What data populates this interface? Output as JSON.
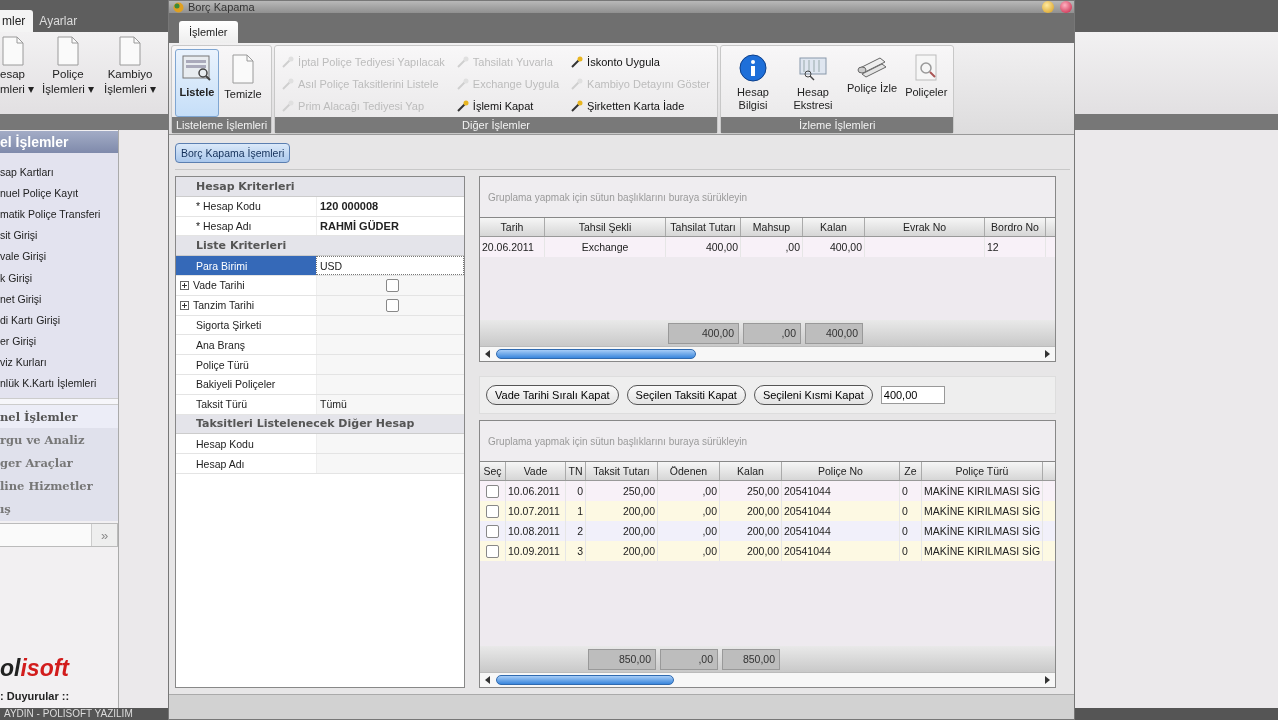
{
  "app": {
    "tabs": [
      {
        "label": "mler",
        "selected": true
      },
      {
        "label": "Ayarlar",
        "selected": false
      }
    ],
    "ribbon": [
      {
        "line1": "esap",
        "line2": "mleri",
        "caret": "▾"
      },
      {
        "line1": "Poliçe",
        "line2": "İşlemleri",
        "caret": "▾"
      },
      {
        "line1": "Kambiyo",
        "line2": "İşlemleri",
        "caret": "▾"
      }
    ],
    "sidebar": {
      "title": "el İşlemler",
      "items": [
        "sap Kartları",
        "nuel Poliçe Kayıt",
        "matik Poliçe Transferi",
        "sit Girişi",
        "vale Girişi",
        "k Girişi",
        "net Girişi",
        "di Kartı Girişi",
        "er Girişi",
        "viz Kurları",
        "nlük K.Kartı İşlemleri"
      ],
      "groups": [
        {
          "label": "nel İşlemler",
          "selected": true
        },
        {
          "label": "rgu ve Analiz",
          "selected": false
        },
        {
          "label": "ger Araçlar",
          "selected": false
        },
        {
          "label": "line Hizmetler",
          "selected": false
        },
        {
          "label": "ış",
          "selected": false
        }
      ],
      "expand": "»"
    },
    "logo": {
      "dark": "ol",
      "accent": "isoft"
    },
    "notice": ": Duyurular ::",
    "status": "AYDIN - POLİSOFT YAZILIM"
  },
  "dialog": {
    "title": "Borç Kapama",
    "tabs": [
      {
        "label": "İşlemler",
        "selected": true
      }
    ],
    "groups": [
      {
        "title": "Listeleme İşlemleri",
        "kind": "large",
        "buttons": [
          {
            "label": "Listele",
            "selected": true
          },
          {
            "label": "Temizle",
            "selected": false
          }
        ]
      },
      {
        "title": "Diğer İşlemler",
        "kind": "small",
        "buttons": [
          {
            "label": "İptal Poliçe Tediyesi Yapılacak",
            "disabled": true
          },
          {
            "label": "Asıl Poliçe Taksitlerini Listele",
            "disabled": true
          },
          {
            "label": "Prim Alacağı Tediyesi Yap",
            "disabled": true
          },
          {
            "label": "Tahsilatı Yuvarla",
            "disabled": true
          },
          {
            "label": "Exchange Uygula",
            "disabled": true
          },
          {
            "label": "İşlemi Kapat",
            "disabled": false
          },
          {
            "label": "İskonto Uygula",
            "disabled": false
          },
          {
            "label": "Kambiyo Detayını Göster",
            "disabled": true
          },
          {
            "label": "Şirketten Karta İade",
            "disabled": false
          }
        ]
      },
      {
        "title": "İzleme İşlemleri",
        "kind": "large",
        "buttons": [
          {
            "label": "Hesap Bilgisi",
            "selected": false
          },
          {
            "label": "Hesap Ekstresi",
            "selected": false
          },
          {
            "label": "Poliçe İzle",
            "selected": false
          },
          {
            "label": "Poliçeler",
            "selected": false
          }
        ]
      }
    ],
    "page_tab": "Borç Kapama İşemleri",
    "criteria": [
      {
        "kind": "section",
        "label": "Hesap Kriterleri"
      },
      {
        "kind": "field",
        "label": "* Hesap Kodu",
        "value": "120 000008",
        "bold": true,
        "selected": false
      },
      {
        "kind": "field",
        "label": "* Hesap Adı",
        "value": "RAHMİ GÜDER",
        "bold": true,
        "selected": false
      },
      {
        "kind": "section",
        "label": "Liste Kriterleri"
      },
      {
        "kind": "field",
        "label": "Para Birimi",
        "value": "USD",
        "bold": false,
        "selected": true
      },
      {
        "kind": "check",
        "label": "Vade Tarihi",
        "checked": false,
        "selected": false,
        "expandable": true
      },
      {
        "kind": "check",
        "label": "Tanzim Tarihi",
        "checked": false,
        "selected": false,
        "expandable": true
      },
      {
        "kind": "field",
        "label": "Sigorta Şirketi",
        "bold": false,
        "selected": false
      },
      {
        "kind": "field",
        "label": "Ana Branş",
        "bold": false,
        "selected": false
      },
      {
        "kind": "field",
        "label": "Poliçe Türü",
        "bold": false,
        "selected": false
      },
      {
        "kind": "field",
        "label": "Bakiyeli Poliçeler",
        "bold": false,
        "selected": false
      },
      {
        "kind": "field",
        "label": "Taksit Türü",
        "value": "Tümü",
        "bold": false,
        "selected": false
      },
      {
        "kind": "section",
        "label": "Taksitleri Listelenecek Diğer Hesap"
      },
      {
        "kind": "field",
        "label": "Hesap Kodu",
        "bold": false,
        "selected": false
      },
      {
        "kind": "field",
        "label": "Hesap Adı",
        "bold": false,
        "selected": false
      }
    ],
    "payments": {
      "group_hint": "Gruplama yapmak için sütun başlıklarını buraya sürükleyin",
      "columns": [
        "Tarih",
        "Tahsil Şekli",
        "Tahsilat Tutarı",
        "Mahsup",
        "Kalan",
        "Evrak No",
        "Bordro No"
      ],
      "rows": [
        [
          "20.06.2011",
          "Exchange",
          "400,00",
          ",00",
          "400,00",
          null,
          "12"
        ]
      ],
      "totals": [
        "400,00",
        ",00",
        "400,00"
      ]
    },
    "actions": [
      "Vade Tarihi Sıralı Kapat",
      "Seçilen Taksiti Kapat",
      "Seçileni Kısmi Kapat"
    ],
    "amount": "400,00",
    "installments": {
      "group_hint": "Gruplama yapmak için sütun başlıklarını buraya sürükleyin",
      "select_header": "Seç",
      "columns": [
        "Vade",
        "TN",
        "Taksit Tutarı",
        "Ödenen",
        "Kalan",
        "Poliçe No",
        "Ze",
        "Poliçe Türü"
      ],
      "rows": [
        {
          "checked": false,
          "cells": [
            "10.06.2011",
            "0",
            "250,00",
            ",00",
            "250,00",
            "20541044",
            "0",
            "MAKİNE KIRILMASI SİG"
          ]
        },
        {
          "checked": false,
          "cells": [
            "10.07.2011",
            "1",
            "200,00",
            ",00",
            "200,00",
            "20541044",
            "0",
            "MAKİNE KIRILMASI SİG"
          ]
        },
        {
          "checked": false,
          "cells": [
            "10.08.2011",
            "2",
            "200,00",
            ",00",
            "200,00",
            "20541044",
            "0",
            "MAKİNE KIRILMASI SİG"
          ]
        },
        {
          "checked": false,
          "cells": [
            "10.09.2011",
            "3",
            "200,00",
            ",00",
            "200,00",
            "20541044",
            "0",
            "MAKİNE KIRILMASI SİG"
          ]
        }
      ],
      "totals": [
        "850,00",
        ",00",
        "850,00"
      ]
    }
  }
}
